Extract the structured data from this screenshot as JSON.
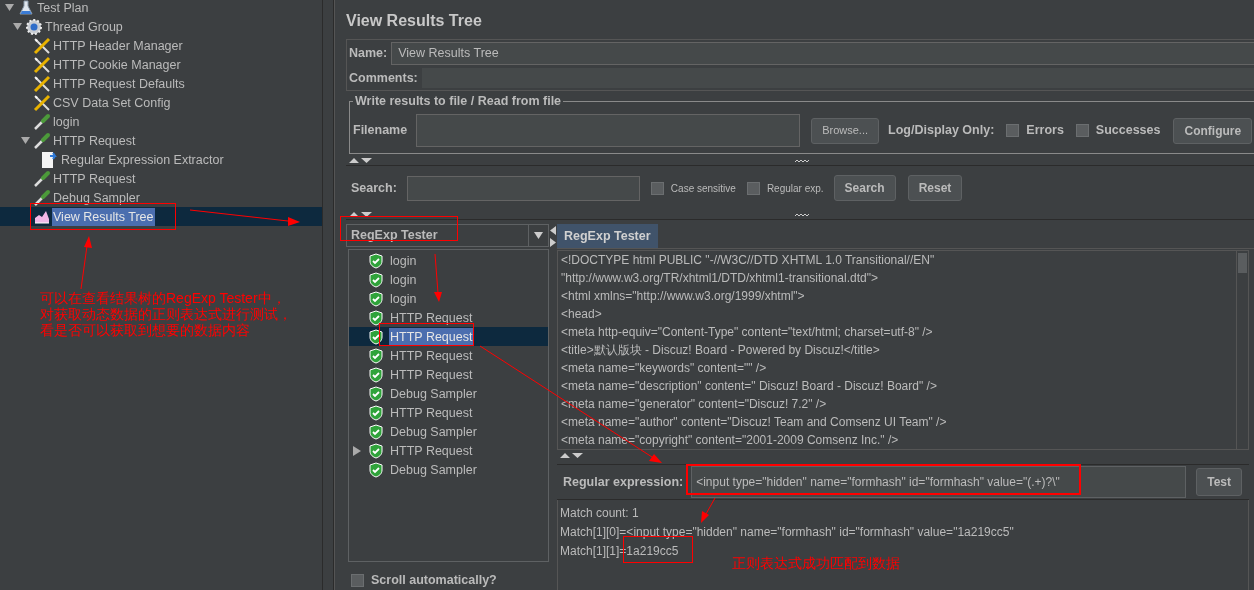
{
  "tree": [
    {
      "label": "Test Plan",
      "kind": "plan",
      "expanded": true,
      "selected": false,
      "children": [
        {
          "label": "Thread Group",
          "kind": "threads",
          "expanded": true,
          "selected": false,
          "children": [
            {
              "label": "HTTP Header Manager",
              "kind": "config",
              "selected": false
            },
            {
              "label": "HTTP Cookie Manager",
              "kind": "config",
              "selected": false
            },
            {
              "label": "HTTP Request Defaults",
              "kind": "config",
              "selected": false
            },
            {
              "label": "CSV Data Set Config",
              "kind": "config",
              "selected": false
            },
            {
              "label": "login",
              "kind": "sampler",
              "selected": false
            },
            {
              "label": "HTTP Request",
              "kind": "sampler",
              "expanded": true,
              "selected": false,
              "children": [
                {
                  "label": "Regular Expression Extractor",
                  "kind": "extractor",
                  "selected": false
                }
              ]
            },
            {
              "label": "HTTP Request",
              "kind": "sampler",
              "selected": false
            },
            {
              "label": "Debug Sampler",
              "kind": "sampler",
              "selected": false
            },
            {
              "label": "View Results Tree",
              "kind": "listener",
              "selected": true
            }
          ]
        }
      ]
    }
  ],
  "panel": {
    "title": "View Results Tree",
    "name_label": "Name:",
    "name_value": "View Results Tree",
    "comments_label": "Comments:",
    "file_group": {
      "legend": "Write results to file / Read from file",
      "filename_label": "Filename",
      "browse": "Browse...",
      "log_label": "Log/Display Only:",
      "checkboxes": [
        {
          "label": "Errors",
          "checked": false
        },
        {
          "label": "Successes",
          "checked": false
        }
      ],
      "configure": "Configure"
    },
    "search": {
      "label": "Search:",
      "checkboxes": [
        {
          "label": "Case sensitive",
          "checked": false
        },
        {
          "label": "Regular exp.",
          "checked": false
        }
      ],
      "search_button": "Search",
      "reset_button": "Reset"
    }
  },
  "results": {
    "view_selector": "RegExp Tester",
    "items": [
      {
        "label": "login",
        "selected": false,
        "expandable": false
      },
      {
        "label": "login",
        "selected": false,
        "expandable": false
      },
      {
        "label": "login",
        "selected": false,
        "expandable": false
      },
      {
        "label": "HTTP Request",
        "selected": false,
        "expandable": false
      },
      {
        "label": "HTTP Request",
        "selected": true,
        "expandable": false
      },
      {
        "label": "HTTP Request",
        "selected": false,
        "expandable": false
      },
      {
        "label": "HTTP Request",
        "selected": false,
        "expandable": false
      },
      {
        "label": "Debug Sampler",
        "selected": false,
        "expandable": false
      },
      {
        "label": "HTTP Request",
        "selected": false,
        "expandable": false
      },
      {
        "label": "Debug Sampler",
        "selected": false,
        "expandable": false
      },
      {
        "label": "HTTP Request",
        "selected": false,
        "expandable": true
      },
      {
        "label": "Debug Sampler",
        "selected": false,
        "expandable": false
      }
    ],
    "scroll_auto": {
      "label": "Scroll automatically?",
      "checked": false
    }
  },
  "tester": {
    "tabs": [
      {
        "label": "RegExp Tester",
        "selected": true
      }
    ],
    "response_lines": [
      "<!DOCTYPE html PUBLIC \"-//W3C//DTD XHTML 1.0 Transitional//EN\"",
      "\"http://www.w3.org/TR/xhtml1/DTD/xhtml1-transitional.dtd\">",
      "<html xmlns=\"http://www.w3.org/1999/xhtml\">",
      "<head>",
      "<meta http-equiv=\"Content-Type\" content=\"text/html; charset=utf-8\" />",
      "<title>默认版块 -  Discuz! Board  - Powered by Discuz!</title>",
      "<meta name=\"keywords\" content=\"\" />",
      "<meta name=\"description\" content=\" Discuz! Board  - Discuz! Board\" />",
      "<meta name=\"generator\" content=\"Discuz! 7.2\" />",
      "<meta name=\"author\" content=\"Discuz! Team and Comsenz UI Team\" />",
      "<meta name=\"copyright\" content=\"2001-2009 Comsenz Inc.\" />"
    ],
    "regex_label": "Regular expression:",
    "regex_value": "<input type=\"hidden\" name=\"formhash\" id=\"formhash\" value=\"(.+)?\\\"",
    "test_button": "Test",
    "match_lines": [
      "Match count: 1",
      "Match[1][0]=<input type=\"hidden\" name=\"formhash\" id=\"formhash\" value=\"1a219cc5\"",
      "Match[1][1]=1a219cc5"
    ]
  },
  "annotations": {
    "note_left": [
      "可以在查看结果树的RegExp Tester中，",
      "对获取动态数据的正则表达式进行测试，",
      "看是否可以获取到想要的数据内容"
    ],
    "note_right": "正则表达式成功匹配到数据"
  }
}
